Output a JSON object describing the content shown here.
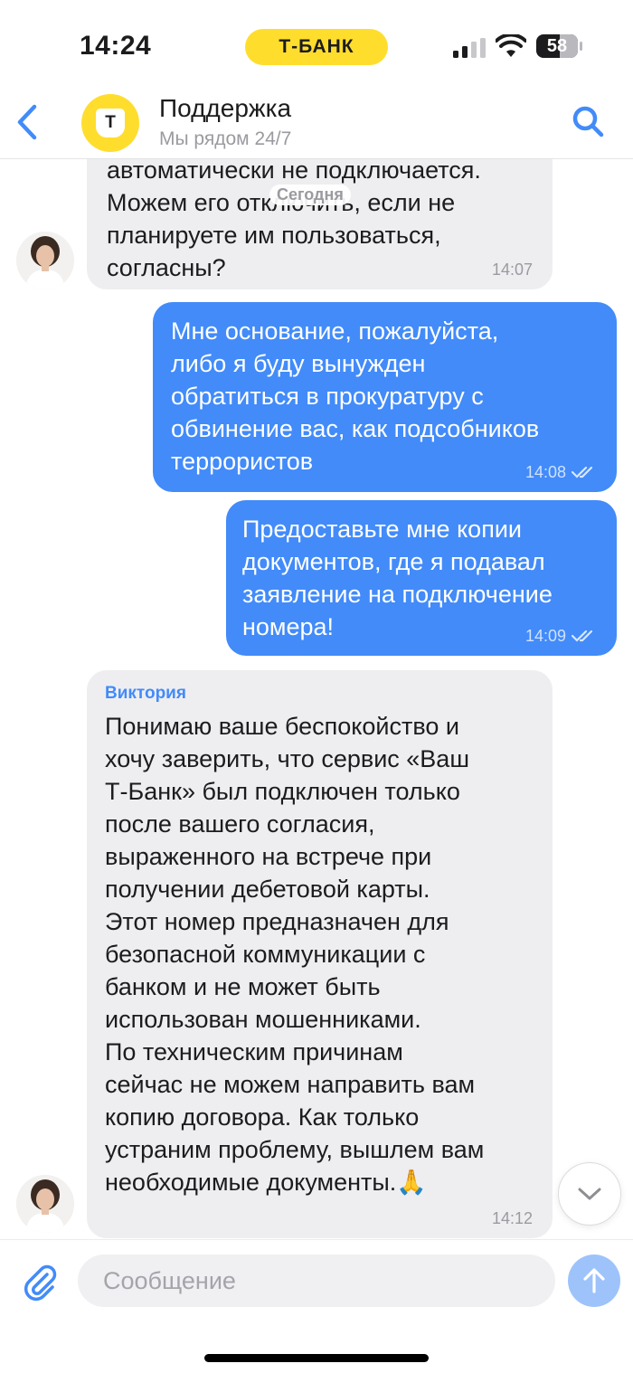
{
  "status_bar": {
    "time": "14:24",
    "carrier_pill": "Т-БАНК",
    "battery": "58"
  },
  "header": {
    "logo_letter": "Т",
    "title": "Поддержка",
    "subtitle": "Мы рядом 24/7",
    "icons": {
      "back": "chevron-left-icon",
      "search": "search-icon"
    }
  },
  "chat": {
    "date_chip": "Сегодня",
    "messages": [
      {
        "direction": "incoming",
        "text": "автоматически не подключается.\nМожем его отключить, если не\nпланируете им пользоваться,\nсогласны?",
        "time": "14:07"
      },
      {
        "direction": "outgoing",
        "text": "Мне основание, пожалуйста,\nлибо я буду вынужден\nобратиться в прокуратуру с\nобвинение вас, как подсобников\nтеррористов",
        "time": "14:08",
        "status": "read"
      },
      {
        "direction": "outgoing",
        "text": "Предоставьте мне копии\nдокументов, где я подавал\nзаявление на подключение\nномера!",
        "time": "14:09",
        "status": "read"
      },
      {
        "direction": "incoming",
        "sender": "Виктория",
        "text": "Понимаю ваше беспокойство и\nхочу заверить, что сервис «Ваш\nТ-Банк» был подключен только\nпосле вашего согласия,\nвыраженного на встрече при\nполучении дебетовой карты.\nЭтот номер предназначен для\nбезопасной коммуникации с\nбанком и не может быть\nиспользован мошенниками.\nПо техническим причинам\nсейчас не можем направить вам\nкопию договора. Как только\nустраним проблему, вышлем вам\nнеобходимые документы.🙏",
        "time": "14:12"
      }
    ]
  },
  "composer": {
    "placeholder": "Сообщение",
    "icons": {
      "attach": "paperclip-icon",
      "send": "arrow-up-icon"
    }
  },
  "colors": {
    "brand_yellow": "#ffdd2d",
    "outgoing_bubble": "#428bf9",
    "incoming_bubble": "#eeeef1",
    "accent_blue": "#428bf9"
  }
}
